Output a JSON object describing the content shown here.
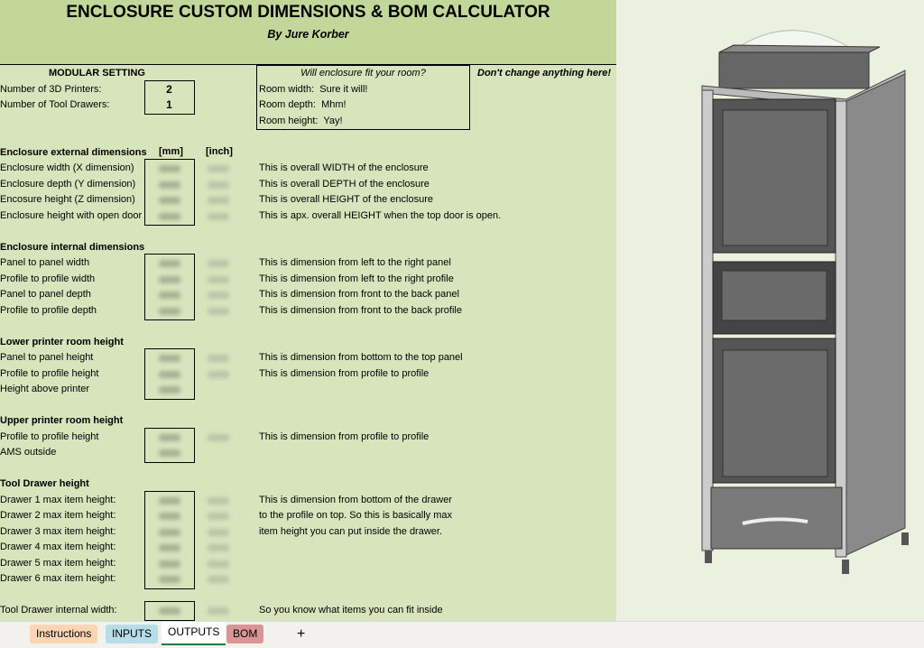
{
  "header": {
    "title": "ENCLOSURE CUSTOM DIMENSIONS & BOM CALCULATOR",
    "subtitle": "By Jure Korber"
  },
  "modular": {
    "heading": "MODULAR SETTING",
    "items": [
      {
        "label": "Number of 3D Printers:",
        "value": "2"
      },
      {
        "label": "Number of Tool Drawers:",
        "value": "1"
      }
    ]
  },
  "room_fit": {
    "heading": "Will enclosure fit your room?",
    "items": [
      {
        "label": "Room width:",
        "value": "Sure it will!"
      },
      {
        "label": "Room depth:",
        "value": "Mhm!"
      },
      {
        "label": "Room height:",
        "value": "Yay!"
      }
    ]
  },
  "warning": "Don't change anything here!",
  "units": {
    "mm": "[mm]",
    "inch": "[inch]"
  },
  "sections": [
    {
      "title": "Enclosure external dimensions",
      "items": [
        {
          "label": "Enclosure width (X dimension)",
          "desc": "This is overall WIDTH of the enclosure"
        },
        {
          "label": "Enclosure depth (Y dimension)",
          "desc": "This is overall DEPTH of the enclosure"
        },
        {
          "label": "Encosure  height (Z dimension)",
          "desc": "This is overall HEIGHT of the enclosure"
        },
        {
          "label": "Enclosure height with open door",
          "desc": "This is apx. overall HEIGHT when the top door is open."
        }
      ]
    },
    {
      "title": "Enclosure internal dimensions",
      "items": [
        {
          "label": "Panel to panel width",
          "desc": "This is dimension from left to the right panel"
        },
        {
          "label": "Profile to profile width",
          "desc": "This is dimension from left to the right profile"
        },
        {
          "label": "Panel to panel depth",
          "desc": "This is dimension from front to the back panel"
        },
        {
          "label": "Profile to profile depth",
          "desc": "This is dimension from front to the back profile"
        }
      ]
    },
    {
      "title": "Lower printer room height",
      "items": [
        {
          "label": "Panel to panel height",
          "desc": "This is dimension from bottom to the top panel"
        },
        {
          "label": "Profile to profile height",
          "desc": "This is dimension from profile to profile"
        },
        {
          "label": "Height above printer",
          "desc": "",
          "noinch": true
        }
      ]
    },
    {
      "title": "Upper printer room height",
      "items": [
        {
          "label": "Profile to profile height",
          "desc": "This is dimension from profile to profile"
        },
        {
          "label": "AMS outside",
          "desc": "",
          "noinch": true
        }
      ]
    },
    {
      "title": "Tool Drawer height",
      "items": [
        {
          "label": "Drawer 1 max item height:",
          "desc": "This is dimension from bottom of the drawer"
        },
        {
          "label": "Drawer 2 max item height:",
          "desc": "to the profile on top. So this is basically max"
        },
        {
          "label": "Drawer 3 max item height:",
          "desc": "item height you can put inside the drawer."
        },
        {
          "label": "Drawer 4 max item height:",
          "desc": ""
        },
        {
          "label": "Drawer 5 max item height:",
          "desc": ""
        },
        {
          "label": "Drawer 6 max item height:",
          "desc": ""
        }
      ]
    },
    {
      "title": "",
      "items": [
        {
          "label": "Tool Drawer internal width:",
          "desc": "So you know what items you can fit inside"
        }
      ]
    }
  ],
  "tabs": [
    {
      "label": "Instructions",
      "color": "#fcd5b4"
    },
    {
      "label": "INPUTS",
      "color": "#b7dee8"
    },
    {
      "label": "OUTPUTS",
      "color": "#ffffff",
      "active": true
    },
    {
      "label": "BOM",
      "color": "#da9694"
    }
  ],
  "add_sheet": "+"
}
